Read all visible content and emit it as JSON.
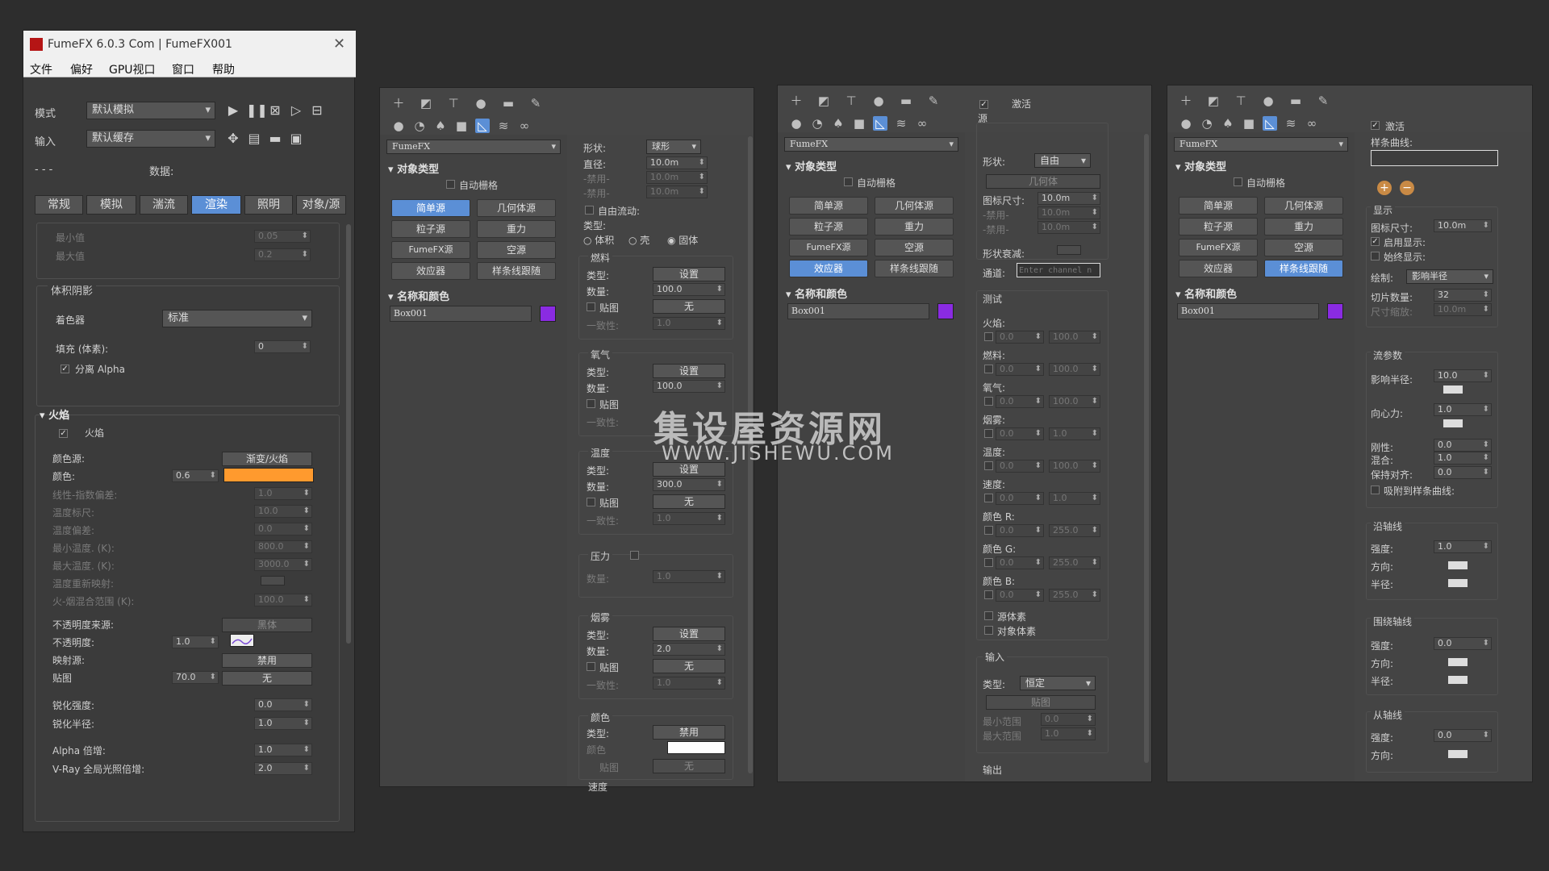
{
  "fumefx": {
    "title": "FumeFX 6.0.3 Com | FumeFX001",
    "menu": [
      "文件",
      "偏好",
      "GPU视口",
      "窗口",
      "帮助"
    ],
    "mode_label": "模式",
    "mode_value": "默认模拟",
    "input_label": "输入",
    "input_value": "默认缓存",
    "data_dashes": "- - -",
    "data_label": "数据:",
    "tabs": [
      "常规",
      "模拟",
      "湍流",
      "渲染",
      "照明",
      "对象/源"
    ],
    "active_tab": "渲染",
    "top": {
      "min_label": "最小值",
      "min_val": "0.05",
      "max_label": "最大值",
      "max_val": "0.2"
    },
    "volume_shadow": {
      "header": "体积阴影",
      "shader_label": "着色器",
      "shader_value": "标准",
      "fill_label": "填充 (体素):",
      "fill_value": "0",
      "sep_alpha": "分离 Alpha"
    },
    "fire": {
      "header": "火焰",
      "enable": "火焰",
      "color_source_label": "颜色源:",
      "color_source_value": "渐变/火焰",
      "color_label": "颜色:",
      "color_val": "0.6",
      "color_hex": "#ff9a2e",
      "rows": [
        {
          "label": "线性-指数偏差:",
          "value": "1.0"
        },
        {
          "label": "温度标尺:",
          "value": "10.0"
        },
        {
          "label": "温度偏差:",
          "value": "0.0"
        },
        {
          "label": "最小温度. (K):",
          "value": "800.0"
        },
        {
          "label": "最大温度. (K):",
          "value": "3000.0"
        },
        {
          "label": "温度重新映射:",
          "value": ""
        },
        {
          "label": "火-烟混合范围 (K):",
          "value": "100.0"
        }
      ],
      "opacity_source_label": "不透明度来源:",
      "opacity_source_value": "黑体",
      "opacity_label": "不透明度:",
      "opacity_value": "1.0",
      "map_source_label": "映射源:",
      "map_source_value": "禁用",
      "map_label": "贴图",
      "map_val": "70.0",
      "map_value": "无",
      "sharpen_strength_label": "锐化强度:",
      "sharpen_strength_value": "0.0",
      "sharpen_radius_label": "锐化半径:",
      "sharpen_radius_value": "1.0",
      "alpha_mult_label": "Alpha 倍增:",
      "alpha_mult_value": "1.0",
      "vray_label": "V-Ray 全局光照倍增:",
      "vray_value": "2.0"
    }
  },
  "panels": {
    "dropdown": "FumeFX",
    "object_type": "对象类型",
    "auto_grid": "自动栅格",
    "buttons": [
      "简单源",
      "几何体源",
      "粒子源",
      "重力",
      "FumeFX源",
      "空源",
      "效应器",
      "样条线跟随"
    ],
    "name_color": "名称和颜色",
    "object_name": "Box001",
    "panel1_active": "简单源",
    "panel2_active": "效应器",
    "panel3_active": "样条线跟随"
  },
  "p1": {
    "shape_label": "形状:",
    "shape_value": "球形",
    "diameter_label": "直径:",
    "diameter_value": "10.0m",
    "disabled1": "-禁用-",
    "disabled2": "-禁用-",
    "free_flow": "自由流动:",
    "type_label": "类型:",
    "type_opts": [
      "体积",
      "壳",
      "固体"
    ],
    "fuel": "燃料",
    "oxygen": "氧气",
    "temp": "温度",
    "pressure": "压力",
    "smoke": "烟雾",
    "color": "颜色",
    "speed": "速度",
    "type": "类型:",
    "amount": "数量:",
    "map": "贴图",
    "consistency": "一致性:",
    "set": "设置",
    "none": "无",
    "disable": "禁用",
    "fuel_amount": "100.0",
    "oxygen_amount": "100.0",
    "temp_amount": "300.0",
    "pressure_amount": "1.0",
    "smoke_amount": "2.0",
    "consistency_val": "1.0",
    "color_label": "颜色"
  },
  "p2": {
    "active": "激活",
    "source": "源",
    "shape_label": "形状:",
    "shape_value": "自由",
    "geometry": "几何体",
    "icon_size_label": "图标尺寸:",
    "icon_size": "10.0m",
    "disabled": "-禁用-",
    "shape_falloff": "形状衰减:",
    "channel_label": "通道:",
    "channel_placeholder": "Enter channel n",
    "test": "测试",
    "test_rows": [
      "火焰:",
      "燃料:",
      "氧气:",
      "烟雾:",
      "温度:",
      "速度:",
      "颜色 R:",
      "颜色 G:",
      "颜色 B:"
    ],
    "test_hi": [
      "100.0",
      "100.0",
      "100.0",
      "1.0",
      "100.0",
      "1.0",
      "255.0",
      "255.0",
      "255.0"
    ],
    "zero": "0.0",
    "source_voxel": "源体素",
    "object_voxel": "对象体素",
    "input": "输入",
    "input_type": "类型:",
    "input_type_val": "恒定",
    "map": "贴图",
    "min_range": "最小范围",
    "max_range": "最大范围",
    "min_val": "0.0",
    "max_val": "1.0",
    "output": "输出"
  },
  "p3": {
    "active": "激活",
    "spline": "样条曲线:",
    "display": "显示",
    "icon_size_label": "图标尺寸:",
    "icon_size": "10.0m",
    "enable_display": "启用显示:",
    "always_display": "始终显示:",
    "draw_label": "绘制:",
    "draw_value": "影响半径",
    "slices_label": "切片数量:",
    "slices": "32",
    "size_scale_label": "尺寸缩放:",
    "size_scale": "10.0m",
    "flow_params": "流参数",
    "influence_radius": "影响半径:",
    "influence_val": "10.0",
    "centripetal": "向心力:",
    "centripetal_val": "1.0",
    "stiffness": "刚性:",
    "stiffness_val": "0.0",
    "blend": "混合:",
    "blend_val": "1.0",
    "keep_align": "保持对齐:",
    "keep_align_val": "0.0",
    "attract": "吸附到样条曲线:",
    "along_axis": "沿轴线",
    "strength": "强度:",
    "along_strength": "1.0",
    "direction": "方向:",
    "radius": "半径:",
    "around_axis": "围绕轴线",
    "around_strength": "0.0",
    "from_axis": "从轴线",
    "from_strength": "0.0"
  },
  "watermark": {
    "line1": "集设屋资源网",
    "line2": "WWW.JISHEWU.COM"
  }
}
